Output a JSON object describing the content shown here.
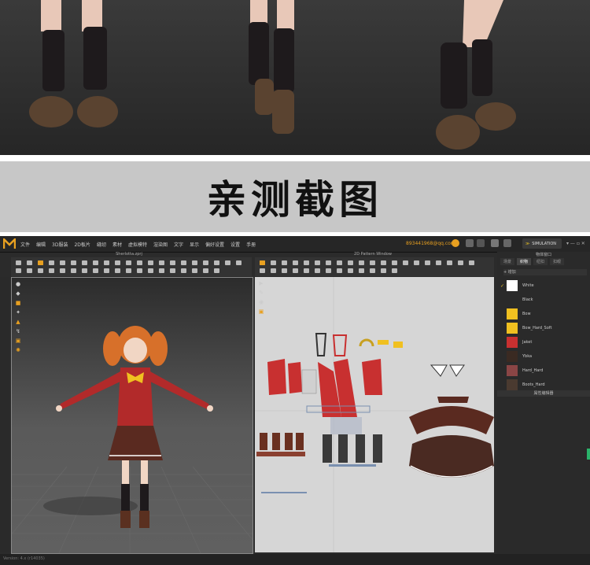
{
  "banner": {
    "title": "亲测截图"
  },
  "menu": {
    "items": [
      "文件",
      "编辑",
      "3D服装",
      "2D板片",
      "缝纫",
      "素材",
      "虚拟模特",
      "渲染图",
      "文字",
      "显示",
      "偏好设置",
      "设置",
      "手册"
    ]
  },
  "toolbar": {
    "email": "893441968@qq.com",
    "simulation": "SIMULATION"
  },
  "viewport3d": {
    "file_title": "Sherlotta.zprj"
  },
  "viewport2d": {
    "title": "2D Pattern Window"
  },
  "object_browser": {
    "title": "物体窗口",
    "tabs": [
      "场景",
      "织物",
      "纽扣",
      "扣眼"
    ],
    "add_label": "+ 增加",
    "fabrics": [
      {
        "name": "White",
        "color": "#ffffff",
        "selected": true
      },
      {
        "name": "Black",
        "color": "#2a2a2a",
        "selected": false
      },
      {
        "name": "Bow",
        "color": "#f0c020",
        "selected": false
      },
      {
        "name": "Bow_Hard_Soft",
        "color": "#f0c020",
        "selected": false
      },
      {
        "name": "Jaket",
        "color": "#c83030",
        "selected": false
      },
      {
        "name": "Ybka",
        "color": "#3a2a22",
        "selected": false
      },
      {
        "name": "Hard_Hard",
        "color": "#8a4545",
        "selected": false
      },
      {
        "name": "Boots_Hard",
        "color": "#4a3a30",
        "selected": false
      }
    ],
    "property_title": "属性编辑器"
  },
  "status": {
    "text": "Version: 4.x (r14035)"
  },
  "colors": {
    "accent": "#e8a020",
    "jacket": "#c83030",
    "skirt": "#5a2a20",
    "bow": "#f0c020"
  }
}
